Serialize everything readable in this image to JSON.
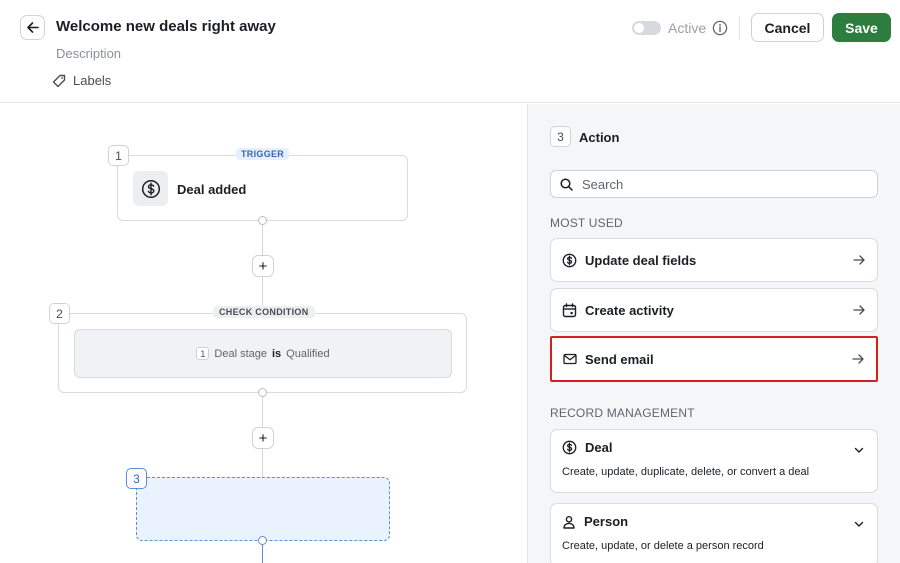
{
  "header": {
    "title": "Welcome new deals right away",
    "description": "Description",
    "labels": "Labels",
    "active_label": "Active",
    "cancel_label": "Cancel",
    "save_label": "Save",
    "active": false
  },
  "canvas": {
    "trigger": {
      "step": "1",
      "badge": "TRIGGER",
      "label": "Deal added"
    },
    "condition": {
      "step": "2",
      "badge": "CHECK CONDITION",
      "rule_num": "1",
      "field": "Deal stage",
      "operator": "is",
      "value": "Qualified"
    },
    "placeholder": {
      "step": "3"
    }
  },
  "panel": {
    "step": "3",
    "title": "Action",
    "search_placeholder": "Search",
    "most_used_heading": "MOST USED",
    "most_used": [
      {
        "label": "Update deal fields",
        "icon": "dollar-circle-icon"
      },
      {
        "label": "Create activity",
        "icon": "calendar-icon"
      },
      {
        "label": "Send email",
        "icon": "mail-icon",
        "highlighted": true
      }
    ],
    "record_heading": "RECORD MANAGEMENT",
    "records": [
      {
        "title": "Deal",
        "description": "Create, update, duplicate, delete, or convert a deal",
        "icon": "dollar-circle-icon"
      },
      {
        "title": "Person",
        "description": "Create, update, or delete a person record",
        "icon": "person-icon"
      }
    ]
  },
  "colors": {
    "accent_green": "#2c7d3e",
    "highlight_red": "#d42020",
    "trigger_blue": "#3967b4"
  }
}
